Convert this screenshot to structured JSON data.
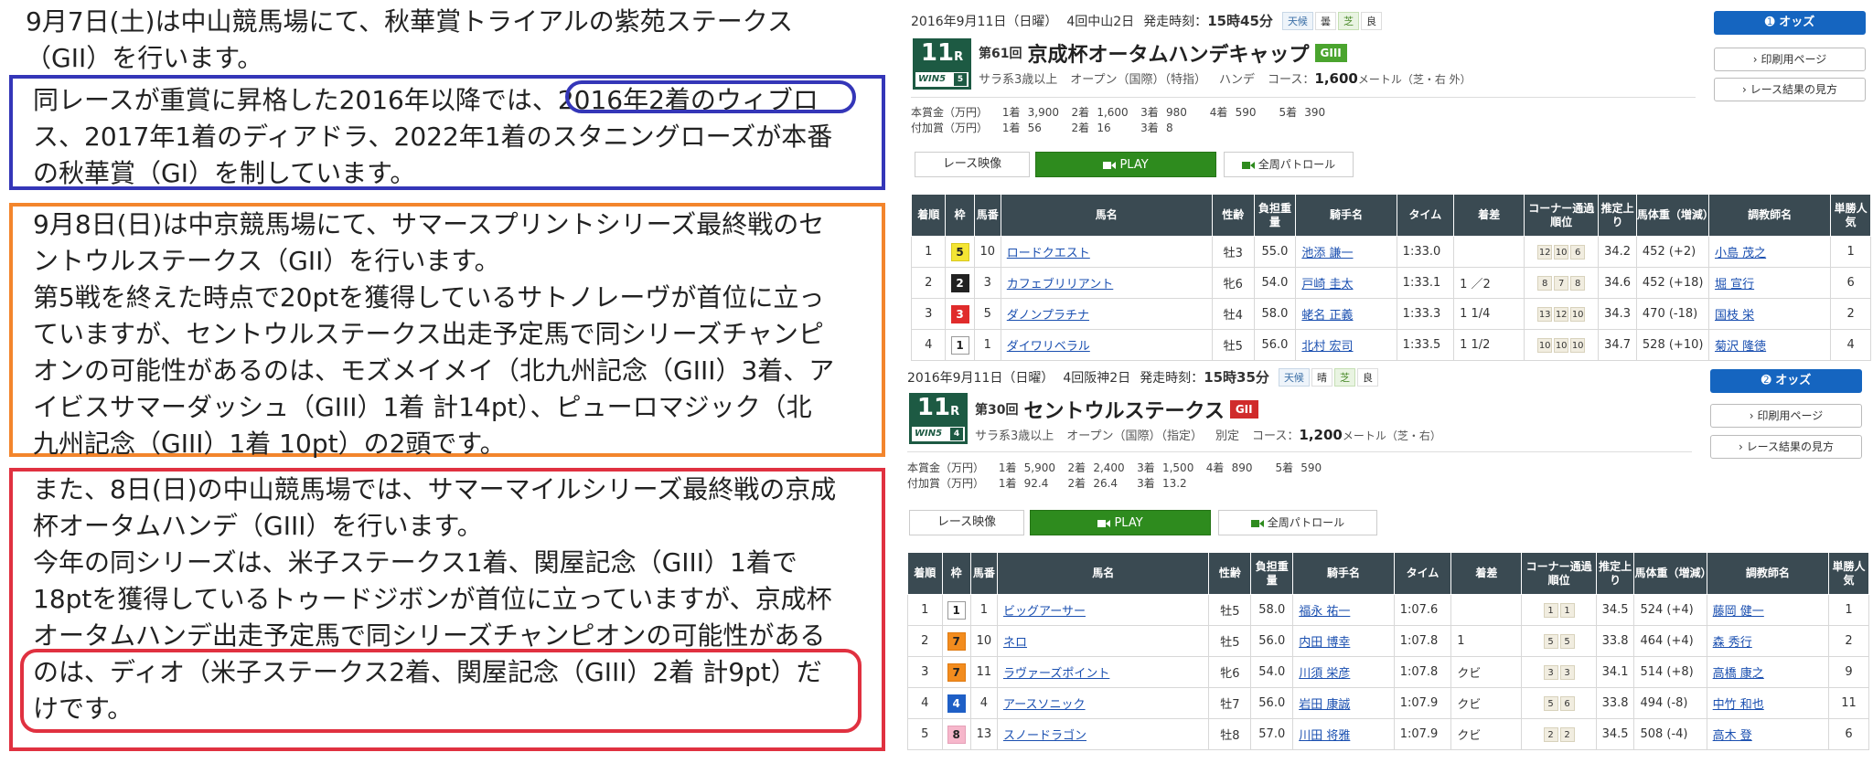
{
  "left": {
    "intro": [
      "9月7日(土)は中山競馬場にて、秋華賞トライアルの紫苑ステークス",
      "（GII）を行います。"
    ],
    "blue_lines": [
      "同レースが重賞に昇格した2016年以降では、2016年2着のウィブロ",
      "ス、2017年1着のディアドラ、2022年1着のスタニングローズが本番",
      "の秋華賞（GI）を制しています。"
    ],
    "orange_lines": [
      "9月8日(日)は中京競馬場にて、サマースプリントシリーズ最終戦のセ",
      "ントウルステークス（GII）を行います。",
      "第5戦を終えた時点で20ptを獲得しているサトノレーヴが首位に立っ",
      "ていますが、セントウルステークス出走予定馬で同シリーズチャンピ",
      "オンの可能性があるのは、モズメイメイ（北九州記念（GIII）3着、ア",
      "イビスサマーダッシュ（GIII）1着 計14pt）、ピューロマジック（北",
      "九州記念（GIII）1着 10pt）の2頭です。"
    ],
    "red_lines": [
      "また、8日(日)の中山競馬場では、サマーマイルシリーズ最終戦の京成",
      "杯オータムハンデ（GIII）を行います。",
      "今年の同シリーズは、米子ステークス1着、関屋記念（GIII）1着で",
      "18ptを獲得しているトゥードジボンが首位に立っていますが、京成杯",
      "オータムハンデ出走予定馬で同シリーズチャンピオンの可能性がある",
      "のは、ディオ（米子ステークス2着、関屋記念（GIII）2着 計9pt）だ",
      "けです。"
    ]
  },
  "race1": {
    "date": "2016年9月11日（日曜）",
    "meeting": "4回中山2日",
    "start_label": "発走時刻：",
    "start_time": "15時45分",
    "weather_label": "天候",
    "weather_value": "曇",
    "track_label": "芝",
    "track_value": "良",
    "race_no": "11",
    "race_unit": "R",
    "win5": "WIN5",
    "win5_no": "5",
    "edition": "第61回",
    "name": "京成杯オータムハンデキャップ",
    "grade": "GIII",
    "cond": [
      "サラ系3歳以上",
      "オープン（国際）（特指）",
      "ハンデ"
    ],
    "course_label": "コース：",
    "distance": "1,600",
    "course_unit": "メートル（芝・右 外）",
    "prize_label": "本賞金（万円）",
    "prize": [
      "1着",
      "3,900",
      "2着",
      "1,600",
      "3着",
      "980",
      "4着",
      "590",
      "5着",
      "390"
    ],
    "add_label": "付加賞（万円）",
    "add": [
      "1着",
      "56",
      "2着",
      "16",
      "3着",
      "8"
    ],
    "btn_odds": "オッズ",
    "btn_print": "印刷用ページ",
    "btn_howto": "レース結果の見方",
    "video_label": "レース映像",
    "play_label": "PLAY",
    "patrol_label": "全周パトロール",
    "headers": [
      "着順",
      "枠",
      "馬番",
      "馬名",
      "性齢",
      "負担重量",
      "騎手名",
      "タイム",
      "着差",
      "コーナー通過順位",
      "推定上り",
      "馬体重（増減）",
      "調教師名",
      "単勝人気"
    ],
    "rows": [
      {
        "rank": "1",
        "waku": "5",
        "num": "10",
        "horse": "ロードクエスト",
        "sex": "牡3",
        "wt": "55.0",
        "jockey": "池添 謙一",
        "time": "1:33.0",
        "margin": "",
        "c": [
          "12",
          "10",
          "6"
        ],
        "last": "34.2",
        "body": "452 (+2)",
        "trainer": "小島 茂之",
        "pop": "1"
      },
      {
        "rank": "2",
        "waku": "2",
        "num": "3",
        "horse": "カフェブリリアント",
        "sex": "牝6",
        "wt": "54.0",
        "jockey": "戸崎 圭太",
        "time": "1:33.1",
        "margin": "1 ／2",
        "c": [
          "8",
          "7",
          "8"
        ],
        "last": "34.6",
        "body": "452 (+18)",
        "trainer": "堀 宣行",
        "pop": "6"
      },
      {
        "rank": "3",
        "waku": "3",
        "num": "5",
        "horse": "ダノンプラチナ",
        "sex": "牡4",
        "wt": "58.0",
        "jockey": "蛯名 正義",
        "time": "1:33.3",
        "margin": "1 1/4",
        "c": [
          "13",
          "12",
          "10"
        ],
        "last": "34.3",
        "body": "470 (-18)",
        "trainer": "国枝 栄",
        "pop": "2"
      },
      {
        "rank": "4",
        "waku": "1",
        "num": "1",
        "horse": "ダイワリベラル",
        "sex": "牡5",
        "wt": "56.0",
        "jockey": "北村 宏司",
        "time": "1:33.5",
        "margin": "1 1/2",
        "c": [
          "10",
          "10",
          "10"
        ],
        "last": "34.7",
        "body": "528 (+10)",
        "trainer": "菊沢 隆徳",
        "pop": "4"
      }
    ]
  },
  "race2": {
    "date": "2016年9月11日（日曜）",
    "meeting": "4回阪神2日",
    "start_label": "発走時刻：",
    "start_time": "15時35分",
    "weather_label": "天候",
    "weather_value": "晴",
    "track_label": "芝",
    "track_value": "良",
    "race_no": "11",
    "race_unit": "R",
    "win5": "WIN5",
    "win5_no": "4",
    "edition": "第30回",
    "name": "セントウルステークス",
    "grade": "GII",
    "cond": [
      "サラ系3歳以上",
      "オープン（国際）（指定）",
      "別定"
    ],
    "course_label": "コース：",
    "distance": "1,200",
    "course_unit": "メートル（芝・右）",
    "prize_label": "本賞金（万円）",
    "prize": [
      "1着",
      "5,900",
      "2着",
      "2,400",
      "3着",
      "1,500",
      "4着",
      "890",
      "5着",
      "590"
    ],
    "add_label": "付加賞（万円）",
    "add": [
      "1着",
      "92.4",
      "2着",
      "26.4",
      "3着",
      "13.2"
    ],
    "btn_odds": "オッズ",
    "btn_print": "印刷用ページ",
    "btn_howto": "レース結果の見方",
    "video_label": "レース映像",
    "play_label": "PLAY",
    "patrol_label": "全周パトロール",
    "headers": [
      "着順",
      "枠",
      "馬番",
      "馬名",
      "性齢",
      "負担重量",
      "騎手名",
      "タイム",
      "着差",
      "コーナー通過順位",
      "推定上り",
      "馬体重（増減）",
      "調教師名",
      "単勝人気"
    ],
    "rows": [
      {
        "rank": "1",
        "waku": "1",
        "num": "1",
        "horse": "ビッグアーサー",
        "sex": "牡5",
        "wt": "58.0",
        "jockey": "福永 祐一",
        "time": "1:07.6",
        "margin": "",
        "c": [
          "1",
          "1"
        ],
        "last": "34.5",
        "body": "524 (+4)",
        "trainer": "藤岡 健一",
        "pop": "1"
      },
      {
        "rank": "2",
        "waku": "7",
        "num": "10",
        "horse": "ネロ",
        "sex": "牡5",
        "wt": "56.0",
        "jockey": "内田 博幸",
        "time": "1:07.8",
        "margin": "1",
        "c": [
          "5",
          "5"
        ],
        "last": "33.8",
        "body": "464 (+4)",
        "trainer": "森 秀行",
        "pop": "2"
      },
      {
        "rank": "3",
        "waku": "7",
        "num": "11",
        "horse": "ラヴァーズポイント",
        "sex": "牝6",
        "wt": "54.0",
        "jockey": "川須 栄彦",
        "time": "1:07.8",
        "margin": "クビ",
        "c": [
          "3",
          "3"
        ],
        "last": "34.1",
        "body": "514 (+8)",
        "trainer": "高橋 康之",
        "pop": "9"
      },
      {
        "rank": "4",
        "waku": "4",
        "num": "4",
        "horse": "アースソニック",
        "sex": "牡7",
        "wt": "56.0",
        "jockey": "岩田 康誠",
        "time": "1:07.9",
        "margin": "クビ",
        "c": [
          "5",
          "6"
        ],
        "last": "33.8",
        "body": "494 (-8)",
        "trainer": "中竹 和也",
        "pop": "11"
      },
      {
        "rank": "5",
        "waku": "8",
        "num": "13",
        "horse": "スノードラゴン",
        "sex": "牡8",
        "wt": "57.0",
        "jockey": "川田 将雅",
        "time": "1:07.9",
        "margin": "クビ",
        "c": [
          "2",
          "2"
        ],
        "last": "34.5",
        "body": "508 (-4)",
        "trainer": "高木 登",
        "pop": "6"
      }
    ]
  },
  "colors": {
    "blue_box": "#3436b8",
    "orange_box": "#f3852c",
    "red_box": "#e03140",
    "race_badge": "#1d5a43",
    "odds_button": "#1565c0",
    "play_button": "#2e8b1e",
    "table_header": "#3a4a52"
  }
}
